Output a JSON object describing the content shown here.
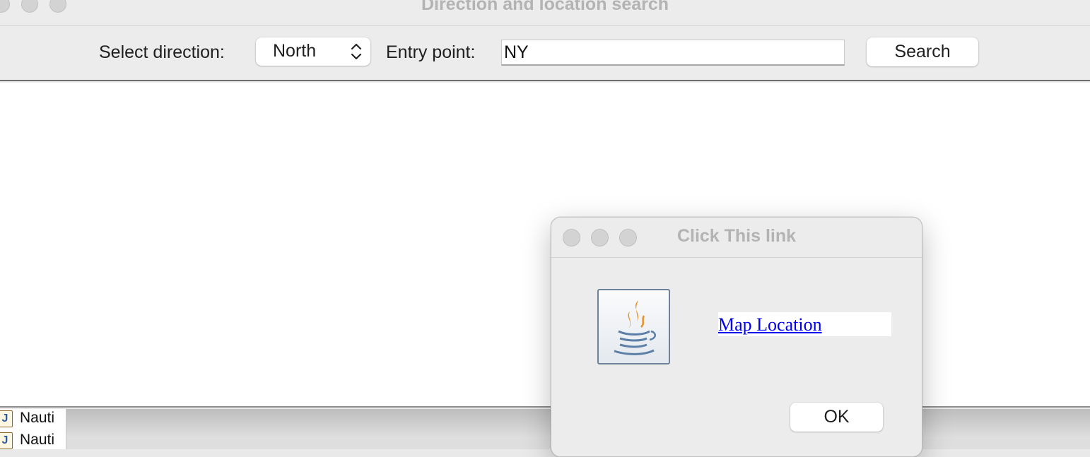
{
  "main_window": {
    "title": "Direction and location search",
    "toolbar": {
      "direction_label": "Select direction:",
      "direction_selected": "North",
      "entry_label": "Entry point:",
      "entry_value": "NY",
      "search_label": "Search"
    }
  },
  "background_window": {
    "files": [
      {
        "icon": "java-file-icon",
        "name": "Nauti"
      },
      {
        "icon": "java-file-icon",
        "name": "Nauti"
      }
    ]
  },
  "dialog": {
    "title": "Click This link",
    "icon": "java-logo-icon",
    "link_text": "Map Location",
    "ok_label": "OK"
  },
  "colors": {
    "link": "#0000ee",
    "window_bg": "#ececec",
    "title_text_inactive": "#b3b3b3"
  }
}
